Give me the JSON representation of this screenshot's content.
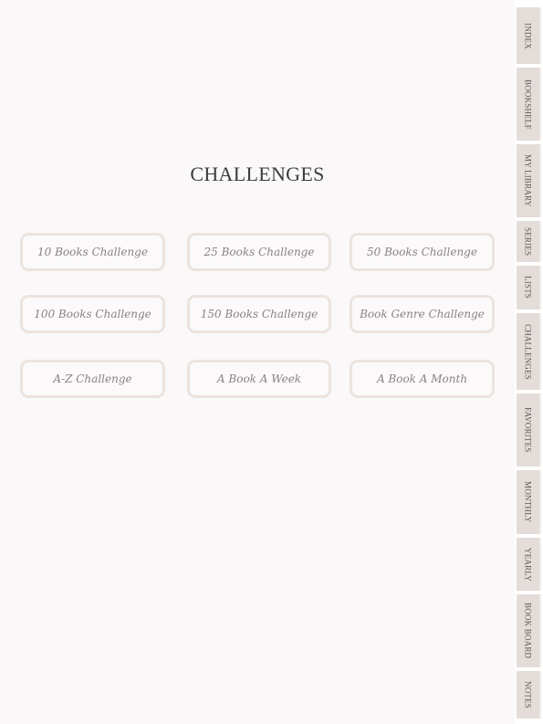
{
  "page": {
    "title": "CHALLENGES"
  },
  "challenges": [
    {
      "label": "10 Books Challenge"
    },
    {
      "label": "25 Books Challenge"
    },
    {
      "label": "50 Books Challenge"
    },
    {
      "label": "100 Books Challenge"
    },
    {
      "label": "150 Books Challenge"
    },
    {
      "label": "Book Genre Challenge"
    },
    {
      "label": "A-Z Challenge"
    },
    {
      "label": "A Book A Week"
    },
    {
      "label": "A Book A Month"
    }
  ],
  "tabs": [
    {
      "label": "INDEX"
    },
    {
      "label": "BOOKSHELF"
    },
    {
      "label": "MY LIBRARY"
    },
    {
      "label": "SERIES"
    },
    {
      "label": "LISTS"
    },
    {
      "label": "CHALLENGES"
    },
    {
      "label": "FAVORITES"
    },
    {
      "label": "MONTHLY"
    },
    {
      "label": "YEARLY"
    },
    {
      "label": "BOOK BOARD"
    },
    {
      "label": "NOTES"
    }
  ],
  "colors": {
    "background": "#faf8f8",
    "button_border": "#ece3df",
    "tab_fill": "#e4dcd8",
    "title_text": "#3d3d3d",
    "button_text": "#8a8282"
  }
}
